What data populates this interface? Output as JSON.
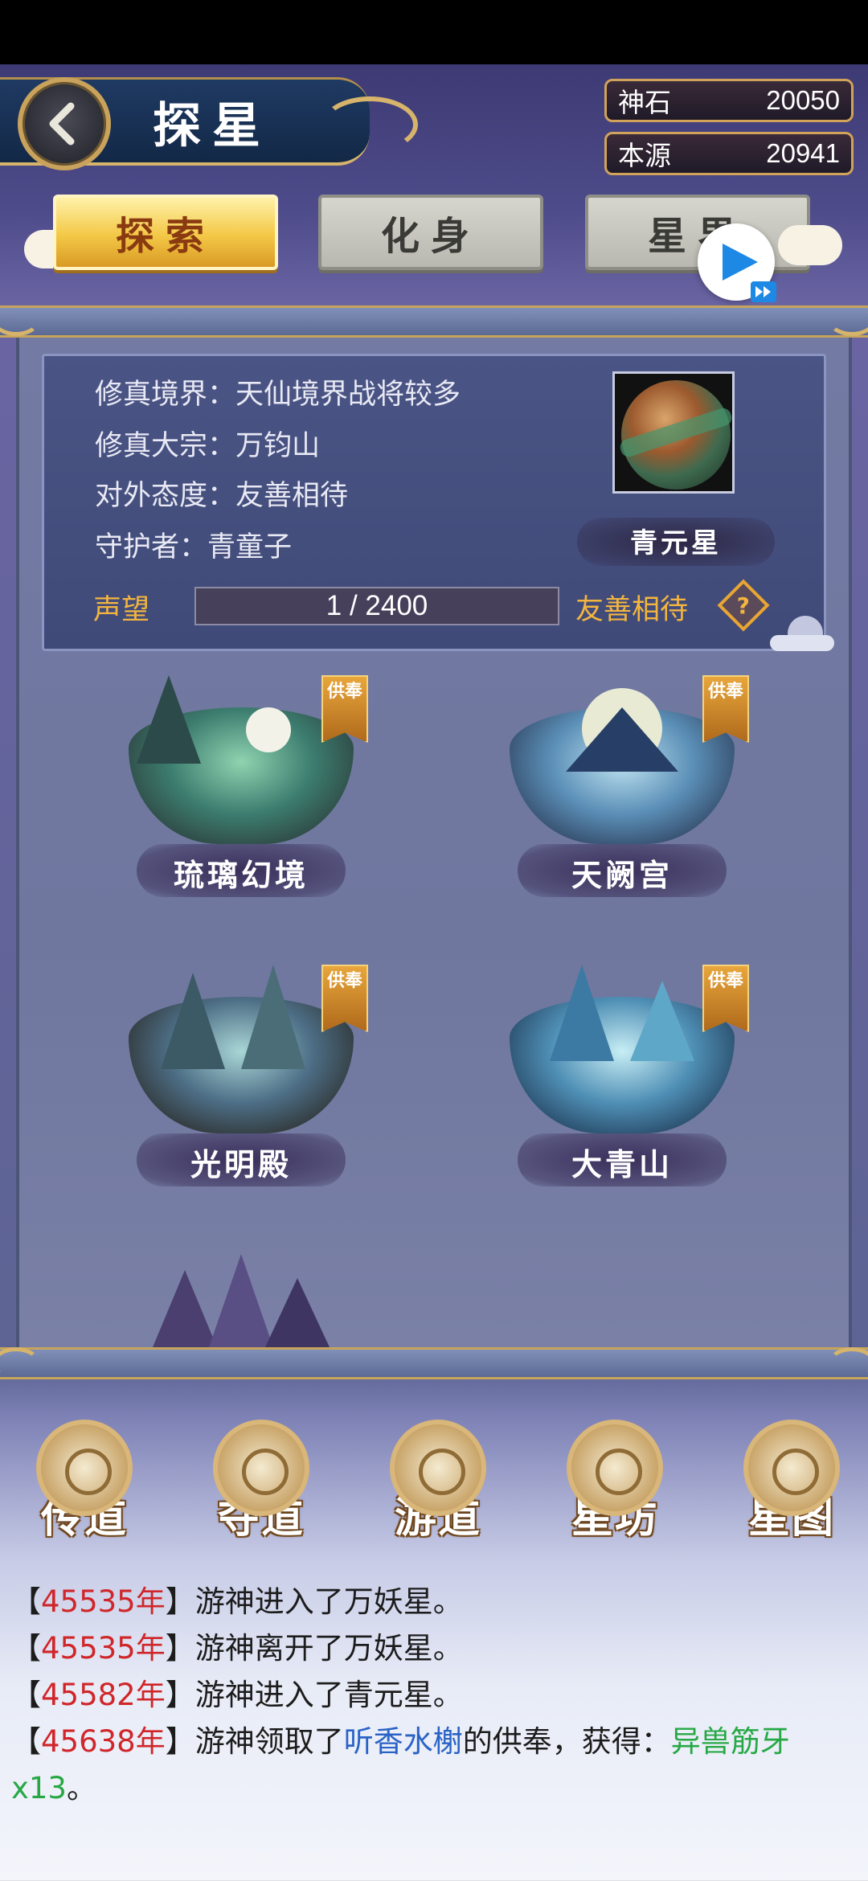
{
  "header": {
    "title": "探星",
    "currencies": [
      {
        "label": "神石",
        "value": "20050"
      },
      {
        "label": "本源",
        "value": "20941"
      }
    ]
  },
  "tabs": [
    {
      "label": "探索",
      "active": true
    },
    {
      "label": "化身",
      "active": false
    },
    {
      "label": "星界",
      "active": false
    }
  ],
  "planet_info": {
    "lines": [
      "修真境界：天仙境界战将较多",
      "修真大宗：万钧山",
      "对外态度：友善相待",
      "守护者：青童子"
    ],
    "planet_name": "青元星",
    "reputation_label": "声望",
    "reputation_value": "1 / 2400",
    "reputation_progress": 0.0004,
    "reputation_status": "友善相待",
    "help_symbol": "?"
  },
  "locations": [
    {
      "name": "琉璃幻境",
      "tag": "供奉",
      "palette": "#3c7d6f"
    },
    {
      "name": "天阙宫",
      "tag": "供奉",
      "palette": "#5b8fb7"
    },
    {
      "name": "光明殿",
      "tag": "供奉",
      "palette": "#4d6e86"
    },
    {
      "name": "大青山",
      "tag": "供奉",
      "palette": "#4f8fb5"
    }
  ],
  "actions": [
    {
      "label": "传道",
      "icon": "triskelion-icon"
    },
    {
      "label": "夺道",
      "icon": "orbit-icon"
    },
    {
      "label": "游道",
      "icon": "triangle-circle-icon"
    },
    {
      "label": "星坊",
      "icon": "constellation-icon"
    },
    {
      "label": "星图",
      "icon": "star-hexagram-icon"
    }
  ],
  "log": [
    {
      "open": "【",
      "year": "45535年",
      "close": "】",
      "text": "游神进入了万妖星。"
    },
    {
      "open": "【",
      "year": "45535年",
      "close": "】",
      "text": "游神离开了万妖星。"
    },
    {
      "open": "【",
      "year": "45582年",
      "close": "】",
      "text": "游神进入了青元星。"
    },
    {
      "open": "【",
      "year": "45638年",
      "close": "】",
      "pre": "游神领取了",
      "link": "听香水榭",
      "mid": "的供奉，获得：",
      "reward": "异兽筋牙x13",
      "end": "。"
    }
  ],
  "colors": {
    "accent_gold": "#f3b53f",
    "year_red": "#d0262a",
    "link_blue": "#2a63c6",
    "reward_green": "#27a845"
  }
}
